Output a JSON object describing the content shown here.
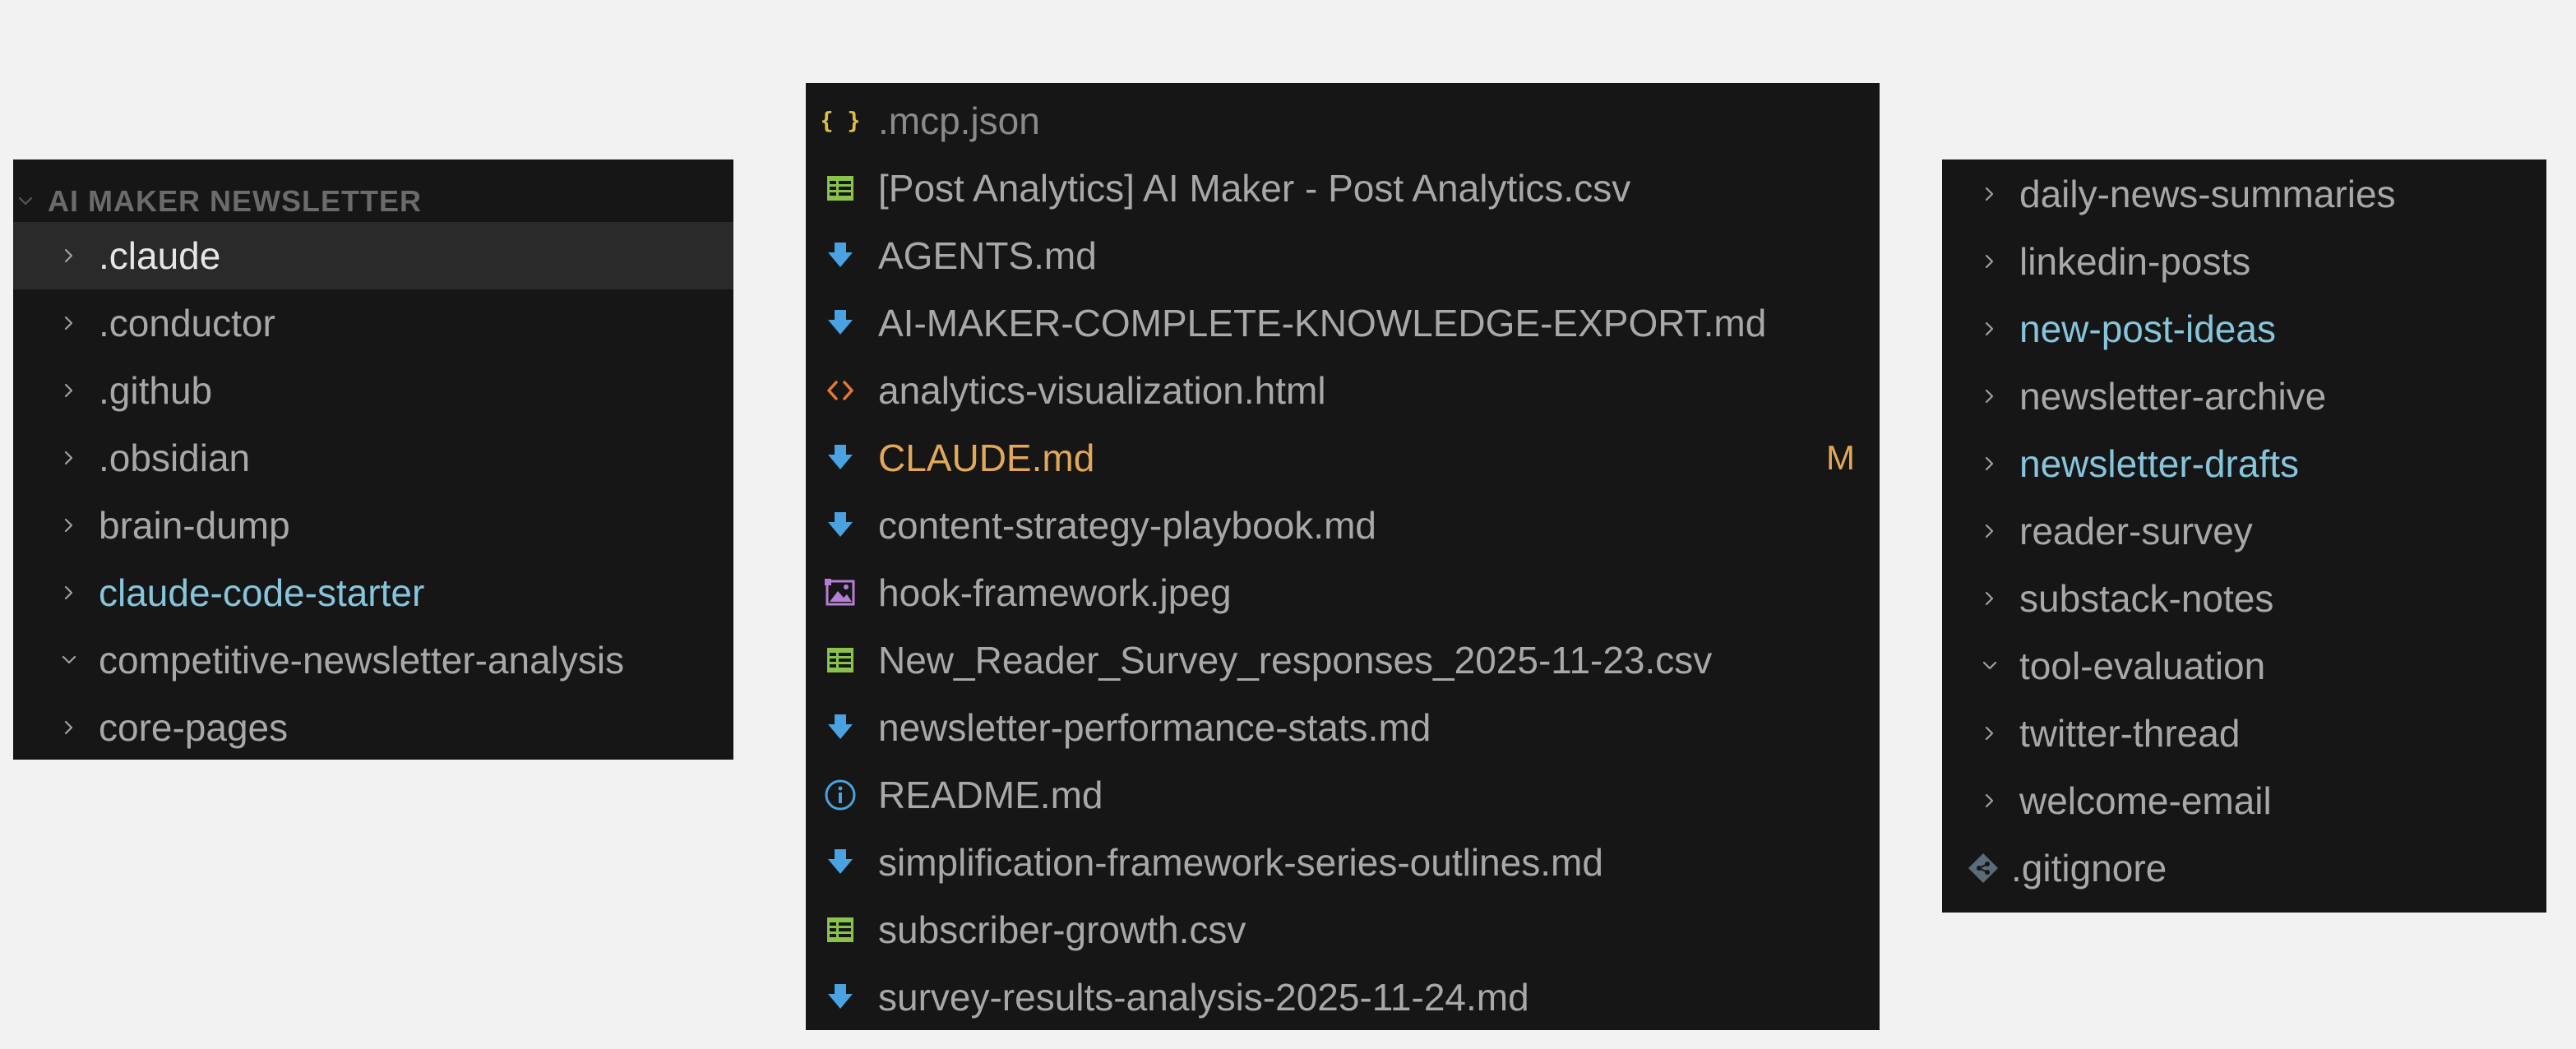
{
  "colors": {
    "background": "#f2f2f2",
    "panel": "#161616",
    "selected_row": "#2a2a2a",
    "default_text": "#a8a8a8",
    "selected_text": "#e6e6e6",
    "header_text": "#6b6b6b",
    "git_untracked_text": "#86c5dc",
    "git_modified_text": "#e2a85a",
    "markdown_icon": "#4aa3e0",
    "csv_icon": "#8bc34a",
    "json_icon": "#d7c04a",
    "html_icon": "#e37933",
    "image_icon": "#b57fd6",
    "info_icon": "#4aa3e0",
    "gitignore_icon": "#5b6b78"
  },
  "left_panel": {
    "title": "AI MAKER NEWSLETTER",
    "items": [
      {
        "label": ".claude",
        "expanded": false,
        "status": "selected"
      },
      {
        "label": ".conductor",
        "expanded": false,
        "status": "normal"
      },
      {
        "label": ".github",
        "expanded": false,
        "status": "normal"
      },
      {
        "label": ".obsidian",
        "expanded": false,
        "status": "normal"
      },
      {
        "label": "brain-dump",
        "expanded": false,
        "status": "normal"
      },
      {
        "label": "claude-code-starter",
        "expanded": false,
        "status": "untracked"
      },
      {
        "label": "competitive-newsletter-analysis",
        "expanded": true,
        "status": "normal"
      },
      {
        "label": "core-pages",
        "expanded": false,
        "status": "normal"
      }
    ]
  },
  "middle_panel": {
    "items": [
      {
        "label": ".mcp.json",
        "icon": "json-braces-icon",
        "status": "ignored"
      },
      {
        "label": "[Post Analytics] AI Maker - Post Analytics.csv",
        "icon": "csv-table-icon",
        "status": "normal"
      },
      {
        "label": "AGENTS.md",
        "icon": "markdown-arrow-icon",
        "status": "normal"
      },
      {
        "label": "AI-MAKER-COMPLETE-KNOWLEDGE-EXPORT.md",
        "icon": "markdown-arrow-icon",
        "status": "normal"
      },
      {
        "label": "analytics-visualization.html",
        "icon": "html-code-icon",
        "status": "normal"
      },
      {
        "label": "CLAUDE.md",
        "icon": "markdown-arrow-icon",
        "status": "modified",
        "badge": "M"
      },
      {
        "label": "content-strategy-playbook.md",
        "icon": "markdown-arrow-icon",
        "status": "normal"
      },
      {
        "label": "hook-framework.jpeg",
        "icon": "image-icon",
        "status": "normal"
      },
      {
        "label": "New_Reader_Survey_responses_2025-11-23.csv",
        "icon": "csv-table-icon",
        "status": "normal"
      },
      {
        "label": "newsletter-performance-stats.md",
        "icon": "markdown-arrow-icon",
        "status": "normal"
      },
      {
        "label": "README.md",
        "icon": "info-icon",
        "status": "normal"
      },
      {
        "label": "simplification-framework-series-outlines.md",
        "icon": "markdown-arrow-icon",
        "status": "normal"
      },
      {
        "label": "subscriber-growth.csv",
        "icon": "csv-table-icon",
        "status": "normal"
      },
      {
        "label": "survey-results-analysis-2025-11-24.md",
        "icon": "markdown-arrow-icon",
        "status": "normal"
      }
    ]
  },
  "right_panel": {
    "items": [
      {
        "label": "daily-news-summaries",
        "kind": "folder",
        "expanded": false,
        "status": "normal"
      },
      {
        "label": "linkedin-posts",
        "kind": "folder",
        "expanded": false,
        "status": "normal"
      },
      {
        "label": "new-post-ideas",
        "kind": "folder",
        "expanded": false,
        "status": "untracked"
      },
      {
        "label": "newsletter-archive",
        "kind": "folder",
        "expanded": false,
        "status": "normal"
      },
      {
        "label": "newsletter-drafts",
        "kind": "folder",
        "expanded": false,
        "status": "untracked"
      },
      {
        "label": "reader-survey",
        "kind": "folder",
        "expanded": false,
        "status": "normal"
      },
      {
        "label": "substack-notes",
        "kind": "folder",
        "expanded": false,
        "status": "normal"
      },
      {
        "label": "tool-evaluation",
        "kind": "folder",
        "expanded": true,
        "status": "normal"
      },
      {
        "label": "twitter-thread",
        "kind": "folder",
        "expanded": false,
        "status": "normal"
      },
      {
        "label": "welcome-email",
        "kind": "folder",
        "expanded": false,
        "status": "normal"
      },
      {
        "label": ".gitignore",
        "kind": "file",
        "icon": "gitignore-icon",
        "status": "normal"
      }
    ]
  }
}
